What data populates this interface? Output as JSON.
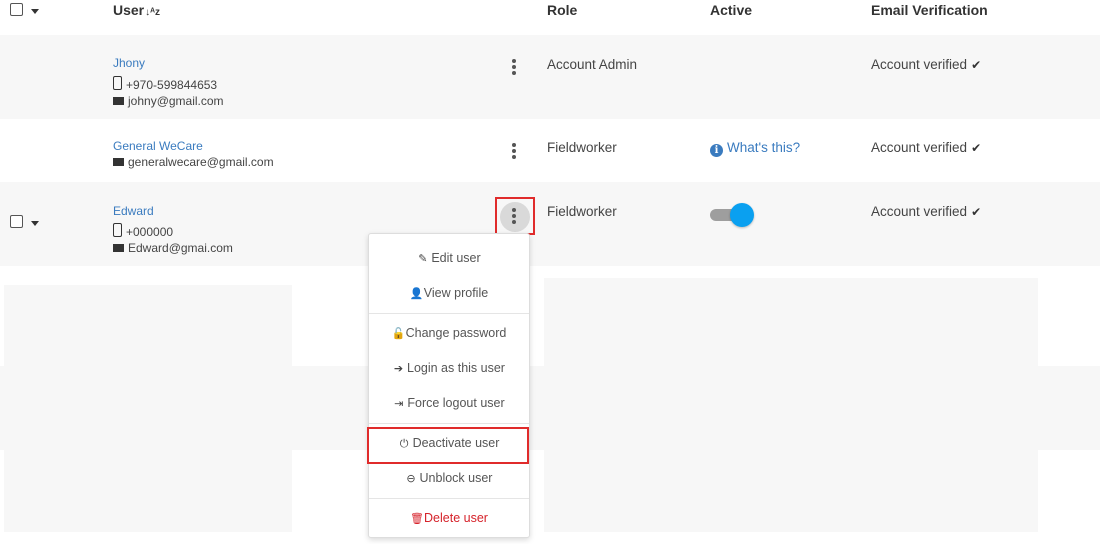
{
  "header": {
    "user_label": "User",
    "sort_icon": "sort-alpha-icon",
    "sort_glyph": "↓ᴬz",
    "role_label": "Role",
    "active_label": "Active",
    "email_verification_label": "Email Verification"
  },
  "rows": [
    {
      "name": "Jhony",
      "phone": "+970-599844653",
      "email": "johny@gmail.com",
      "role": "Account Admin",
      "verification": "Account verified"
    },
    {
      "name": "General WeCare",
      "email": "generalwecare@gmail.com",
      "role": "Fieldworker",
      "active_link": "What's this?",
      "verification": "Account verified"
    },
    {
      "name": "Edward",
      "phone": "+000000",
      "email": "Edward@gmai.com",
      "role": "Fieldworker",
      "active": true,
      "verification": "Account verified"
    }
  ],
  "context_menu": {
    "edit_user": "Edit user",
    "view_profile": "View profile",
    "change_password": "Change password",
    "login_as_user": "Login as this user",
    "force_logout": "Force logout user",
    "deactivate_user": "Deactivate user",
    "unblock_user": "Unblock user",
    "delete_user": "Delete user"
  },
  "colors": {
    "link": "#3a7bbf",
    "toggle_on": "#0aa0f0",
    "highlight": "#e02b2b",
    "danger": "#d6222a"
  }
}
